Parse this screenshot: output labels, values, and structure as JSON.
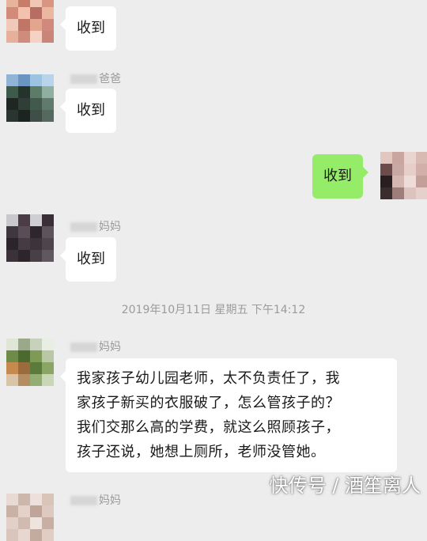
{
  "messages": {
    "m1": {
      "text": "收到"
    },
    "m2": {
      "sender_suffix": "爸爸",
      "text": "收到"
    },
    "m3": {
      "text": "收到"
    },
    "m4": {
      "sender_suffix": "妈妈",
      "text": "收到"
    },
    "timestamp": "2019年10月11日 星期五 下午14:12",
    "m5": {
      "sender_suffix": "妈妈",
      "lines": [
        "我家孩子幼儿园老师，太不负责任了，我",
        "家孩子新买的衣服破了，怎么管孩子的？",
        "我们交那么高的学费，就这么照顾孩子，",
        "孩子还说，她想上厕所，老师没管她。"
      ]
    },
    "m6": {
      "sender_suffix": "妈妈"
    }
  },
  "watermark": "快传号 / 酒笙离人",
  "colors": {
    "background": "#ededed",
    "bubble_self": "#95ec69",
    "bubble_other": "#ffffff"
  },
  "icons": {
    "avatars": "pixelated-avatar"
  }
}
